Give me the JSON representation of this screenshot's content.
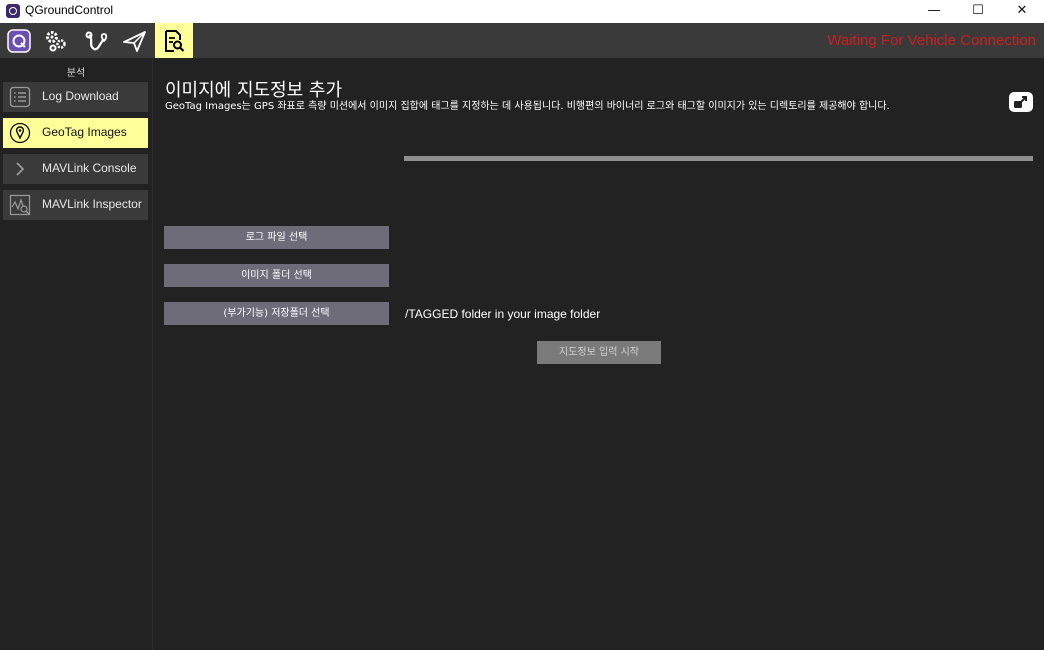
{
  "window": {
    "title": "QGroundControl",
    "controls": {
      "minimize": "—",
      "maximize": "☐",
      "close": "✕"
    }
  },
  "toolbar": {
    "status": "Waiting For Vehicle Connection",
    "buttons": [
      "qgc-logo-icon",
      "gears-icon",
      "plan-route-icon",
      "paper-plane-icon",
      "analyze-icon"
    ],
    "status_color": "#cc1f1f",
    "active_color": "#ffff99"
  },
  "sidebar": {
    "title": "분석",
    "items": [
      {
        "label": "Log Download",
        "icon": "list-icon",
        "active": false
      },
      {
        "label": "GeoTag Images",
        "icon": "map-pin-icon",
        "active": true
      },
      {
        "label": "MAVLink Console",
        "icon": "chevron-right-icon",
        "active": false
      },
      {
        "label": "MAVLink Inspector",
        "icon": "chart-inspector-icon",
        "active": false
      }
    ]
  },
  "main": {
    "title": "이미지에 지도정보 추가",
    "description": "GeoTag Images는 GPS 좌표로 측량 미션에서 이미지 집합에 태그를 지정하는 데 사용됩니다. 비행편의 바이너리 로그와 태그할 이미지가 있는 디렉토리를 제공해야 합니다.",
    "progress": 0,
    "buttons": {
      "select_log": "로그 파일 선택",
      "select_images": "이미지 폴더 선택",
      "select_save": "(부가기능) 저장폴더 선택",
      "start": "지도정보 입력 시작"
    },
    "save_folder_note": "/TAGGED folder in your image folder"
  }
}
